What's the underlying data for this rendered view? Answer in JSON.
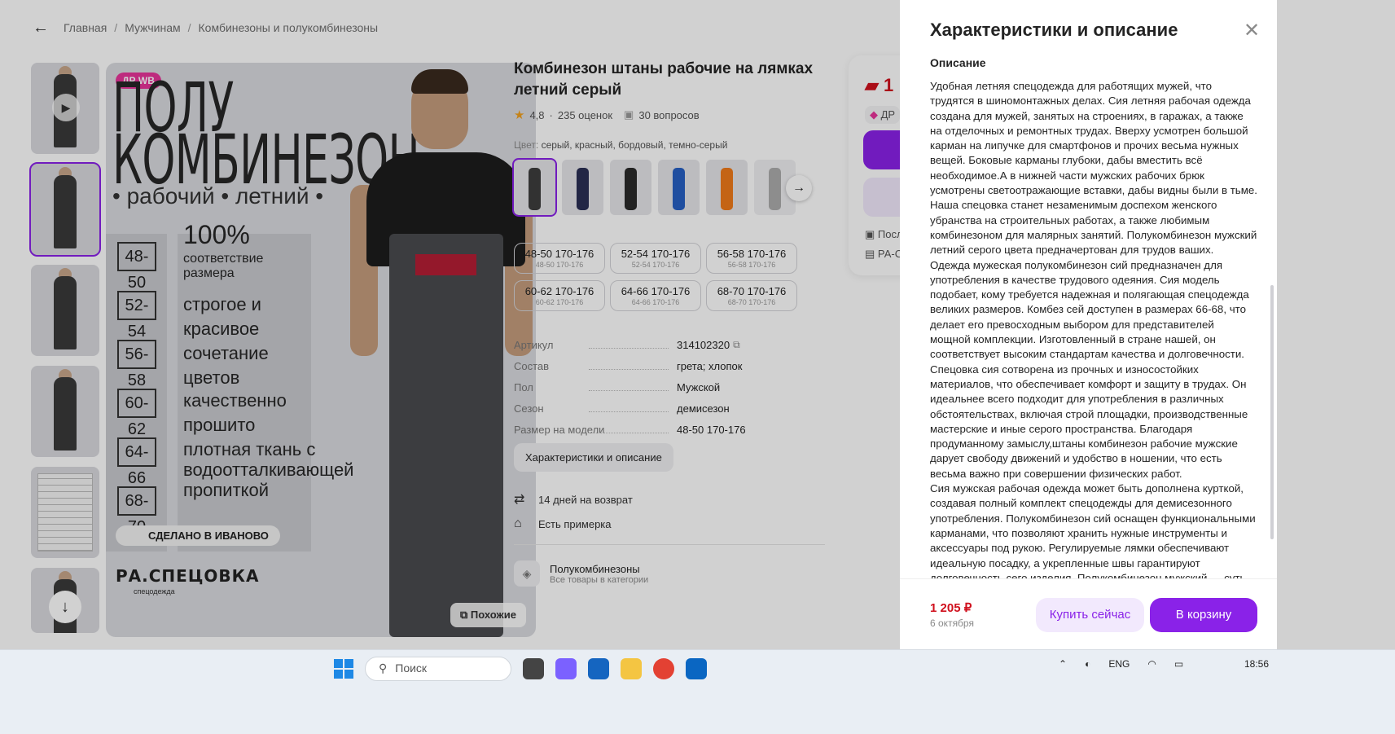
{
  "breadcrumbs": [
    "Главная",
    "Мужчинам",
    "Комбинезоны и полукомбинезоны"
  ],
  "image": {
    "badge": "ДР WB",
    "heading_line1": "ПОЛУ",
    "heading_line2": "КОМБИНЕЗОН",
    "subheading": "• рабочий • летний •",
    "sizes": [
      "48-50",
      "52-54",
      "56-58",
      "60-62",
      "64-66",
      "68-70"
    ],
    "feature_big": "100%",
    "feature_small": "соответствие размера",
    "features": [
      "строгое и красивое сочетание цветов",
      "качественно прошито",
      "плотная ткань с водоотталкивающей пропиткой"
    ],
    "made_in": "СДЕЛАНО В ИВАНОВО",
    "brand": "РА.СПЕЦОВКА",
    "brand_sub": "спецодежда",
    "similar_label": "Похожие"
  },
  "product": {
    "title": "Комбинезон штаны рабочие на лямках летний серый",
    "rating": "4,8",
    "reviews": "235 оценок",
    "questions": "30 вопросов",
    "color_label": "Цвет:",
    "color_value": "серый, красный, бордовый, темно-серый",
    "size_options": [
      {
        "main": "48-50 170-176",
        "sub": "48-50 170-176"
      },
      {
        "main": "52-54 170-176",
        "sub": "52-54 170-176"
      },
      {
        "main": "56-58 170-176",
        "sub": "56-58 170-176"
      },
      {
        "main": "60-62 170-176",
        "sub": "60-62 170-176"
      },
      {
        "main": "64-66 170-176",
        "sub": "64-66 170-176"
      },
      {
        "main": "68-70 170-176",
        "sub": "68-70 170-176"
      }
    ],
    "specs": [
      {
        "key": "Артикул",
        "value": "314102320"
      },
      {
        "key": "Состав",
        "value": "грета; хлопок"
      },
      {
        "key": "Пол",
        "value": "Мужской"
      },
      {
        "key": "Сезон",
        "value": "демисезон"
      },
      {
        "key": "Размер на модели",
        "value": "48-50 170-176"
      }
    ],
    "characteristics_button": "Характеристики и описание",
    "return_text": "14 дней на возврат",
    "fitting_text": "Есть примерка",
    "category_title": "Полукомбинезоны",
    "category_sub": "Все товары в категории"
  },
  "buy_card": {
    "price_partial": "1",
    "dr_partial": "ДР",
    "line1": "Посл",
    "line2": "РА-С"
  },
  "panel": {
    "title": "Характеристики и описание",
    "section": "Описание",
    "paragraphs": [
      "Удобная летняя спецодежда для работящих мужей, что трудятся в шиномонтажных делах. Сия летняя рабочая одежда создана для мужей, занятых на строениях, в гаражах, а также на отделочных и ремонтных трудах. Вверху усмотрен большой карман на липучке для смартфонов и прочих весьма нужных вещей. Боковые карманы глубоки, дабы вместить всё необходимое.А в нижней части мужских рабочих брюк усмотрены светоотражающие вставки, дабы видны были в тьме. Наша спецовка станет незаменимым доспехом женского убранства на строительных работах, а также любимым комбинезоном для малярных занятий. Полукомбинезон мужский летний серого цвета предначертован для трудов ваших.",
      "Одежда мужеская полукомбинезон сий предназначен для употребления в качестве трудового одеяния. Сия модель подобает, кому требуется надежная и полягающая спецодежда великих размеров. Комбез сей доступен в размерах 66-68, что делает его превосходным выбором для представителей мощной комплекции. Изготовленный в стране нашей, он соответствует высоким стандартам качества и долговечности.",
      "Спецовка сия сотворена из прочных и износостойких материалов, что обеспечивает комфорт и защиту в трудах. Он идеальнее всего подходит для употребления в различных обстоятельствах, включая строй площадки, производственные мастерские и иные серого пространства. Благодаря продуманному замыслу,штаны комбинезон рабочие мужские дарует свободу движений и удобство в ношении, что есть весьма важно при совершении физических работ.",
      "Сия мужская рабочая одежда может быть дополнена курткой, создавая полный комплект спецодежды для демисезонного употребления. Полукомбинезон сий оснащен функциональными карманами, что позволяют хранить нужные инструменты и аксессуары под рукою. Регулируемые лямки обеспечивают идеальную посадку, а укрепленные швы гарантируют долговечность сего изделия. Полукомбинезон мужский — суть"
    ],
    "price": "1 205 ₽",
    "date": "6 октября",
    "buy_now": "Купить сейчас",
    "to_cart": "В корзину"
  },
  "taskbar": {
    "search": "Поиск",
    "lang": "ENG",
    "time": "18:56"
  },
  "colors": {
    "accent": "#8a22e8",
    "price": "#d0101d",
    "badge": "#e8359a"
  }
}
